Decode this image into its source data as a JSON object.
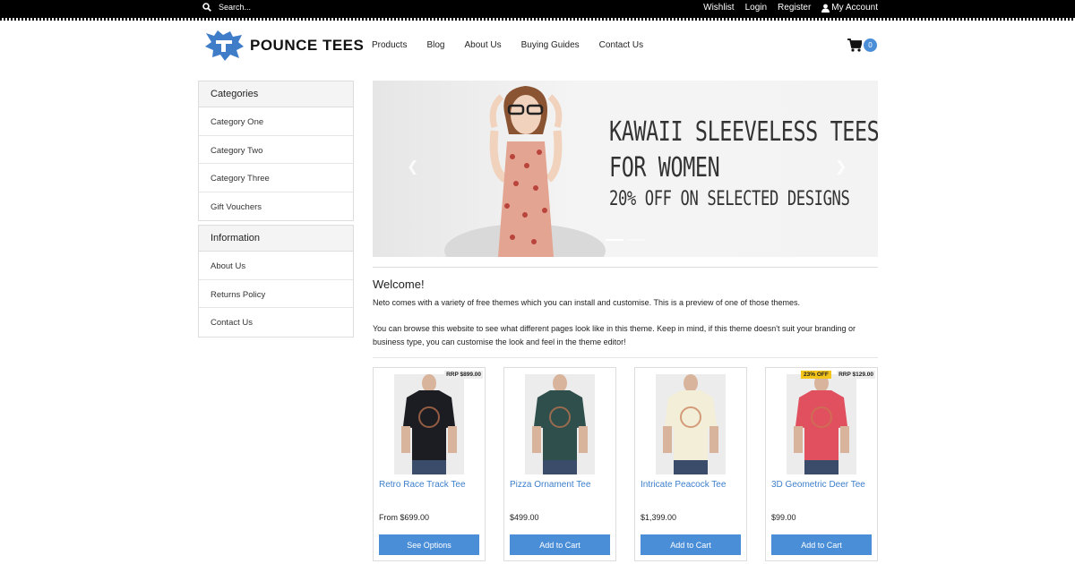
{
  "topbar": {
    "search_placeholder": "Search...",
    "links": [
      "Wishlist",
      "Login",
      "Register"
    ],
    "account_label": "My Account"
  },
  "brand": {
    "name": "POUNCE TEES",
    "accent": "#4a8ed8"
  },
  "nav": [
    "Products",
    "Blog",
    "About Us",
    "Buying Guides",
    "Contact Us"
  ],
  "cart": {
    "count": "0"
  },
  "sidebar": {
    "categories_title": "Categories",
    "categories": [
      "Category One",
      "Category Two",
      "Category Three",
      "Gift Vouchers"
    ],
    "information_title": "Information",
    "information": [
      "About Us",
      "Returns Policy",
      "Contact Us"
    ]
  },
  "hero": {
    "line1": "KAWAII SLEEVELESS TEES",
    "line2": "FOR WOMEN",
    "line3": "20% OFF ON SELECTED DESIGNS"
  },
  "welcome": {
    "title": "Welcome!",
    "p1": "Neto comes with a variety of free themes which you can install and customise. This is a preview of one of those themes.",
    "p2": "You can browse this website to see what different pages look like in this theme. Keep in mind, if this theme doesn't suit your branding or business type, you can customise the look and feel in the theme editor!"
  },
  "products": [
    {
      "name": "Retro Race Track Tee",
      "price": "From $699.00",
      "rrp": "RRP $899.00",
      "discount": "",
      "button": "See Options",
      "shirt_color": "#1c1d22"
    },
    {
      "name": "Pizza Ornament Tee",
      "price": "$499.00",
      "rrp": "",
      "discount": "",
      "button": "Add to Cart",
      "shirt_color": "#2f4f4c"
    },
    {
      "name": "Intricate Peacock Tee",
      "price": "$1,399.00",
      "rrp": "",
      "discount": "",
      "button": "Add to Cart",
      "shirt_color": "#f2eed8"
    },
    {
      "name": "3D Geometric Deer Tee",
      "price": "$99.00",
      "rrp": "RRP $129.00",
      "discount": "23% OFF",
      "button": "Add to Cart",
      "shirt_color": "#e0505f"
    }
  ]
}
